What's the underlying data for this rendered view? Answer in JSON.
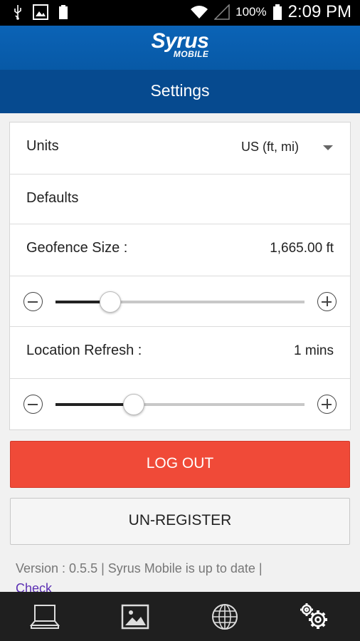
{
  "status_bar": {
    "battery_percent": "100%",
    "time": "2:09 PM"
  },
  "brand": {
    "name": "Syrus",
    "subtitle": "MOBILE"
  },
  "header": {
    "title": "Settings"
  },
  "settings": {
    "units": {
      "label": "Units",
      "value": "US (ft, mi)"
    },
    "defaults": {
      "label": "Defaults"
    },
    "geofence": {
      "label": "Geofence Size :",
      "value": "1,665.00 ft",
      "slider_fraction": 0.22
    },
    "location_refresh": {
      "label": "Location Refresh :",
      "value": "1 mins",
      "slider_fraction": 0.315
    }
  },
  "buttons": {
    "logout_label": "LOG OUT",
    "unregister_label": "UN-REGISTER"
  },
  "footer": {
    "version_text": "Version : 0.5.5 | Syrus Mobile is up to date |",
    "check_link": "Check"
  },
  "nav": [
    {
      "icon": "laptop-icon"
    },
    {
      "icon": "image-icon"
    },
    {
      "icon": "globe-icon"
    },
    {
      "icon": "gears-icon"
    }
  ],
  "colors": {
    "brand_blue": "#0b63b6",
    "title_blue": "#064a8f",
    "logout_red": "#f04a38",
    "link_purple": "#5b2fb3"
  }
}
